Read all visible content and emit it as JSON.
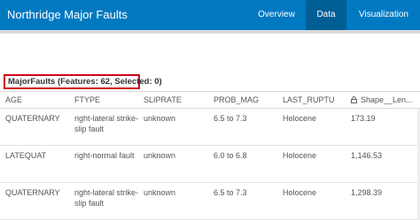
{
  "header": {
    "title": "Northridge Major Faults",
    "tabs": [
      {
        "label": "Overview",
        "active": false
      },
      {
        "label": "Data",
        "active": true
      },
      {
        "label": "Visualization",
        "active": false
      }
    ]
  },
  "layer": {
    "label": "MajorFaults (Features: 62, Selected: 0)"
  },
  "table": {
    "columns": [
      "AGE",
      "FTYPE",
      "SLIPRATE",
      "PROB_MAG",
      "LAST_RUPTU",
      "Shape__Len..."
    ],
    "rows": [
      [
        "QUATERNARY",
        "right-lateral strike-slip fault",
        "unknown",
        "6.5 to 7.3",
        "Holocene",
        "173.19"
      ],
      [
        "LATEQUAT",
        "right-normal fault",
        "unknown",
        "6.0 to 6.8",
        "Holocene",
        "1,146.53"
      ],
      [
        "QUATERNARY",
        "right-lateral strike-slip fault",
        "unknown",
        "6.5 to 7.3",
        "Holocene",
        "1,298.39"
      ]
    ]
  },
  "colors": {
    "header_bg": "#0079c1",
    "active_tab_bg": "#005e95",
    "highlight_border": "#d0021b"
  },
  "icons": {
    "shape_column": "lock-icon"
  }
}
